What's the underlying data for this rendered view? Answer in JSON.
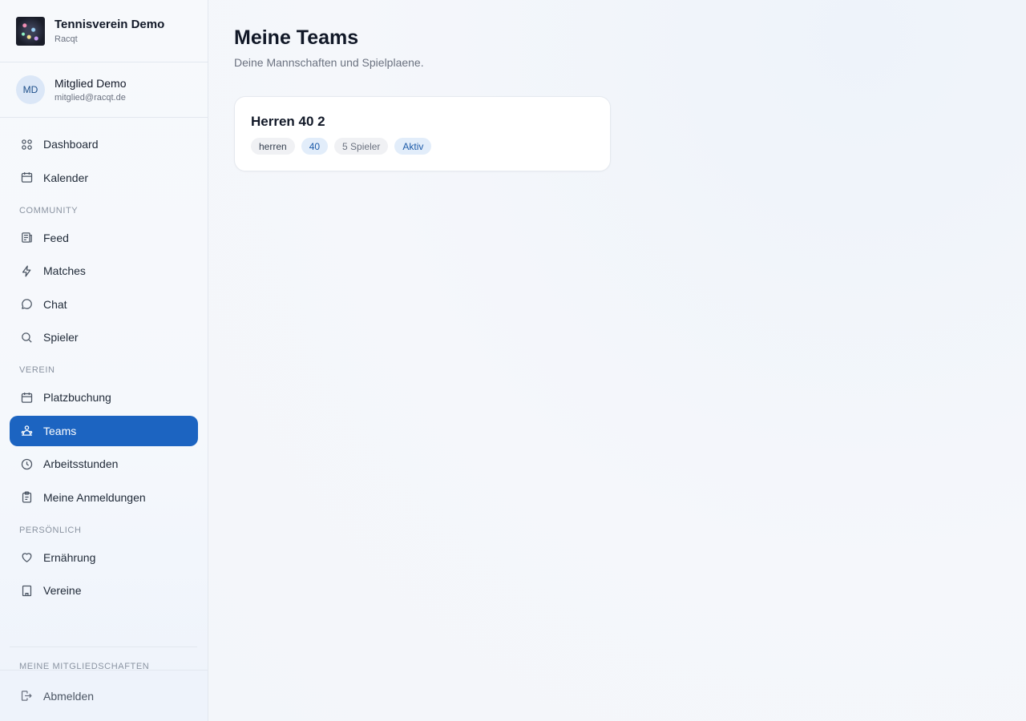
{
  "brand": {
    "name": "Tennisverein Demo",
    "sub": "Racqt"
  },
  "user": {
    "initials": "MD",
    "name": "Mitglied Demo",
    "email": "mitglied@racqt.de"
  },
  "nav": {
    "main": [
      {
        "label": "Dashboard",
        "icon": "grid-icon"
      },
      {
        "label": "Kalender",
        "icon": "calendar-icon"
      }
    ],
    "community_label": "COMMUNITY",
    "community": [
      {
        "label": "Feed",
        "icon": "newspaper-icon"
      },
      {
        "label": "Matches",
        "icon": "lightning-icon"
      },
      {
        "label": "Chat",
        "icon": "chat-bubble-icon"
      },
      {
        "label": "Spieler",
        "icon": "search-icon"
      }
    ],
    "verein_label": "VEREIN",
    "verein": [
      {
        "label": "Platzbuchung",
        "icon": "calendar-icon"
      },
      {
        "label": "Teams",
        "icon": "team-icon",
        "active": true
      },
      {
        "label": "Arbeitsstunden",
        "icon": "clock-icon"
      },
      {
        "label": "Meine Anmeldungen",
        "icon": "clipboard-icon"
      }
    ],
    "personal_label": "PERSÖNLICH",
    "personal": [
      {
        "label": "Ernährung",
        "icon": "heart-icon"
      },
      {
        "label": "Vereine",
        "icon": "building-icon"
      }
    ],
    "memberships_label": "MEINE MITGLIEDSCHAFTEN",
    "logout_label": "Abmelden"
  },
  "page": {
    "title": "Meine Teams",
    "subtitle": "Deine Mannschaften und Spielplaene."
  },
  "teams": [
    {
      "name": "Herren 40 2",
      "tags": {
        "gender": "herren",
        "age": "40",
        "players": "5 Spieler",
        "status": "Aktiv"
      }
    }
  ],
  "colors": {
    "accent": "#1c64c1",
    "tag_blue_bg": "#e2edfa",
    "tag_blue_text": "#1c5aa8"
  }
}
